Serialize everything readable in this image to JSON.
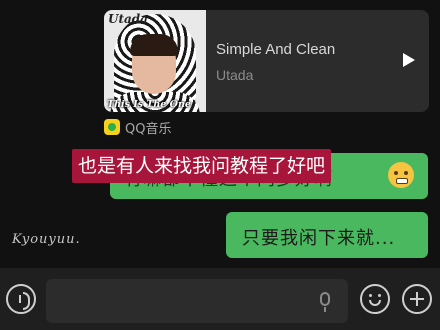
{
  "music_card": {
    "cover_artist_text": "Utada",
    "cover_album_text": "This Is The One",
    "song_title": "Simple And Clean",
    "artist": "Utada"
  },
  "source": {
    "app_label": "QQ音乐"
  },
  "messages": [
    {
      "text": "有嘛都不懂这个问多好啊"
    },
    {
      "text": "只要我闲下来就..."
    }
  ],
  "caption": "也是有人来找我问教程了好吧",
  "signature": "Kyouyuu.",
  "colors": {
    "background": "#111111",
    "bubble_green": "#49b85e",
    "caption_red": "#a8153a",
    "card": "#2c2c2c"
  },
  "icons": {
    "play": "play-icon",
    "voice": "voice-icon",
    "mic": "mic-icon",
    "emoji": "emoji-icon",
    "plus": "plus-icon"
  }
}
